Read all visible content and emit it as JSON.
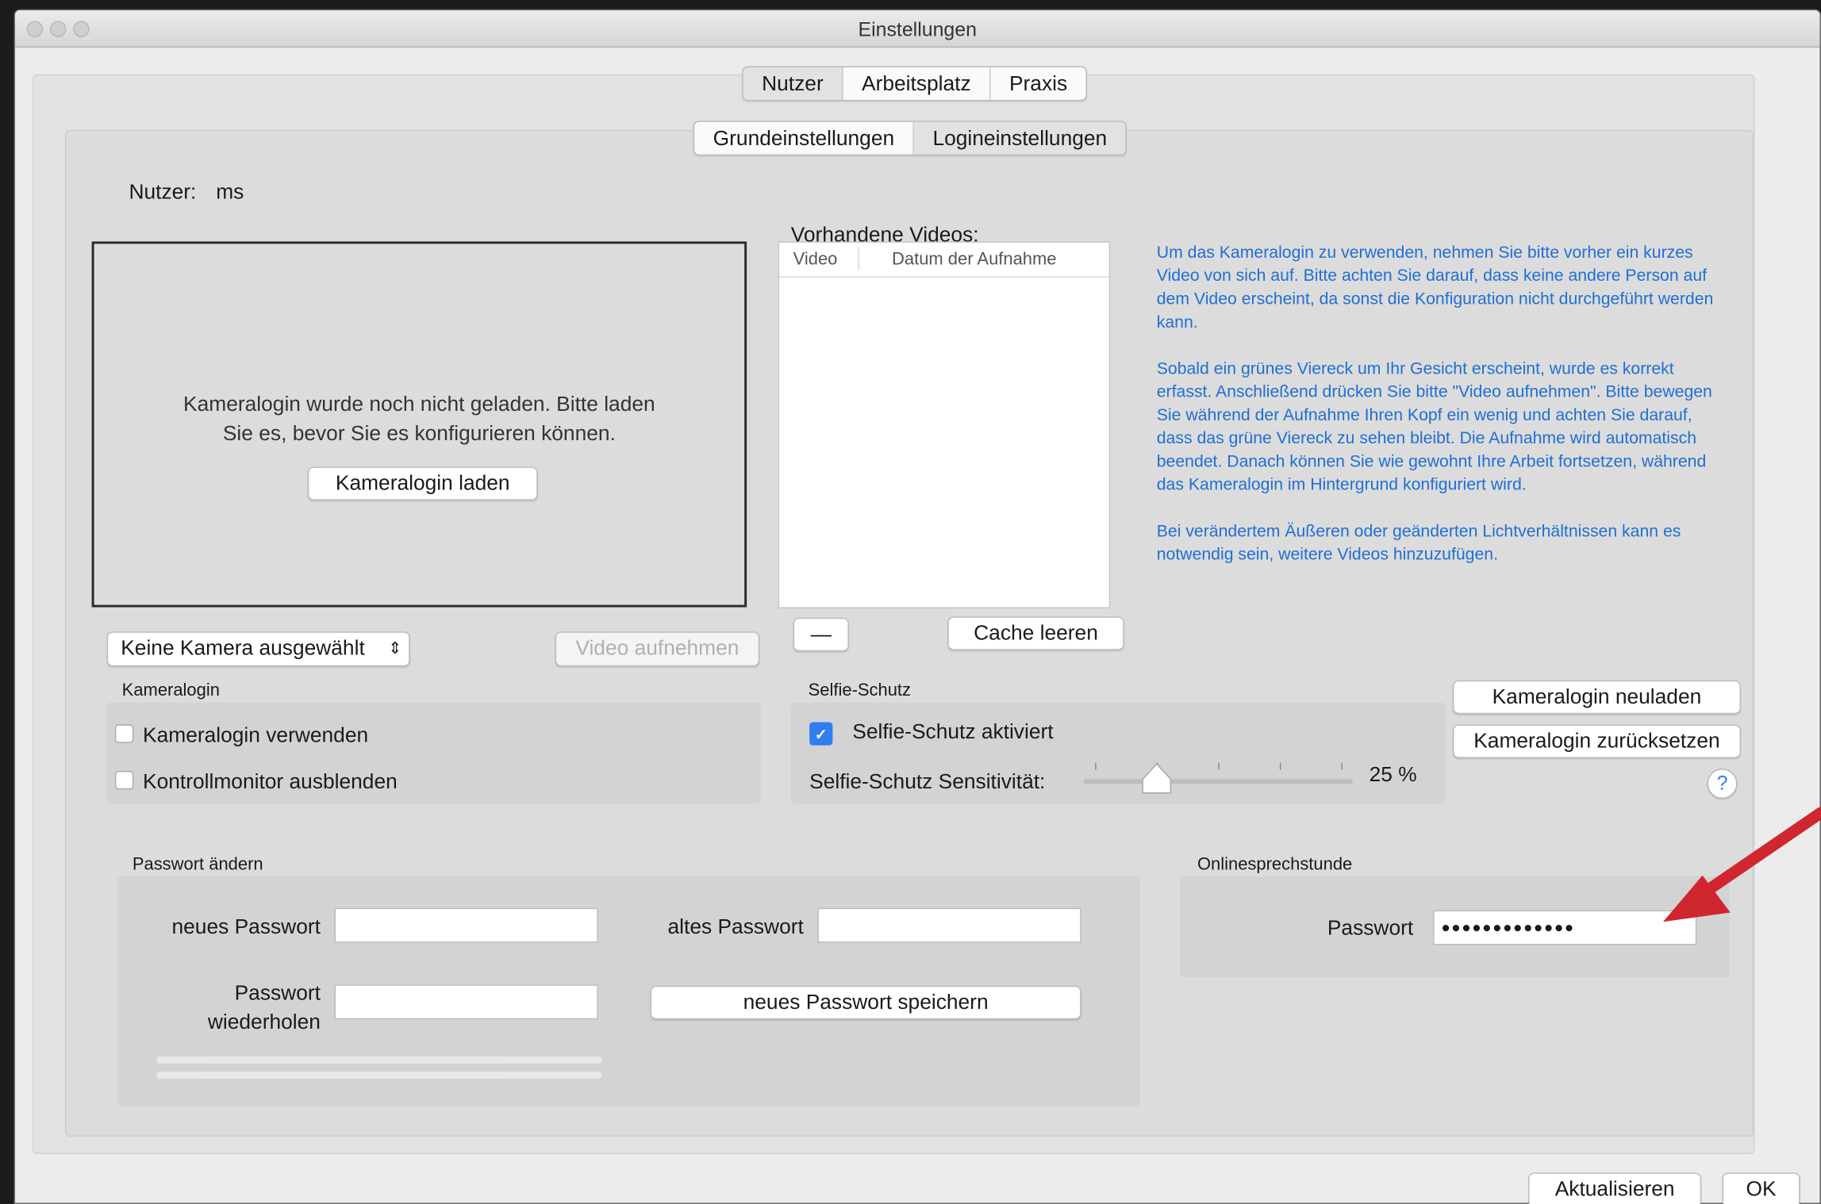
{
  "window": {
    "title": "Einstellungen"
  },
  "top_tabs": [
    "Nutzer",
    "Arbeitsplatz",
    "Praxis"
  ],
  "sub_tabs": [
    "Grundeinstellungen",
    "Logineinstellungen"
  ],
  "user": {
    "label": "Nutzer:",
    "value": "ms"
  },
  "camera": {
    "message_line1": "Kameralogin wurde noch nicht geladen. Bitte laden",
    "message_line2": "Sie es, bevor Sie es konfigurieren können.",
    "load_button": "Kameralogin laden",
    "select_value": "Keine Kamera ausgewählt",
    "record_button": "Video aufnehmen"
  },
  "videos": {
    "title": "Vorhandene Videos:",
    "columns": [
      "Video",
      "Datum der Aufnahme"
    ],
    "rows": [],
    "remove_button": "—",
    "clear_button": "Cache leeren"
  },
  "info": {
    "p1": "Um das Kameralogin zu verwenden, nehmen Sie bitte vorher ein kurzes Video von sich auf. Bitte achten Sie darauf, dass keine andere Person auf dem Video erscheint, da sonst die Konfiguration nicht durchgeführt werden kann.",
    "p2": "Sobald ein grünes Viereck um Ihr Gesicht erscheint, wurde es korrekt erfasst. Anschließend drücken Sie bitte \"Video aufnehmen\". Bitte bewegen Sie während der Aufnahme Ihren Kopf ein wenig und achten Sie darauf, dass das grüne Viereck zu sehen bleibt. Die Aufnahme wird automatisch beendet. Danach können Sie wie gewohnt Ihre Arbeit fortsetzen, während das Kameralogin im Hintergrund konfiguriert wird.",
    "p3": "Bei verändertem Äußeren oder geänderten Lichtverhältnissen kann es notwendig sein, weitere Videos hinzuzufügen."
  },
  "kameralogin": {
    "group_title": "Kameralogin",
    "use_label": "Kameralogin verwenden",
    "use_checked": false,
    "hide_monitor_label": "Kontrollmonitor ausblenden",
    "hide_monitor_checked": false
  },
  "selfie": {
    "group_title": "Selfie-Schutz",
    "active_label": "Selfie-Schutz aktiviert",
    "active_checked": true,
    "sensitivity_label": "Selfie-Schutz Sensitivität:",
    "sensitivity_value": "25 %",
    "sensitivity_fraction": 0.25
  },
  "side_buttons": {
    "reload": "Kameralogin neuladen",
    "reset": "Kameralogin zurücksetzen",
    "help": "?"
  },
  "password_change": {
    "group_title": "Passwort ändern",
    "new_label": "neues Passwort",
    "new_value": "",
    "old_label": "altes Passwort",
    "old_value": "",
    "repeat_label_line1": "Passwort",
    "repeat_label_line2": "wiederholen",
    "repeat_value": "",
    "save_button": "neues Passwort speichern"
  },
  "online": {
    "group_title": "Onlinesprechstunde",
    "password_label": "Passwort",
    "password_value": "●●●●●●●●●●●●●"
  },
  "footer": {
    "update_button": "Aktualisieren",
    "ok_button": "OK"
  },
  "colors": {
    "info_text": "#1f6fd6",
    "checkbox_on": "#2f7ff0",
    "arrow": "#d0262f"
  }
}
